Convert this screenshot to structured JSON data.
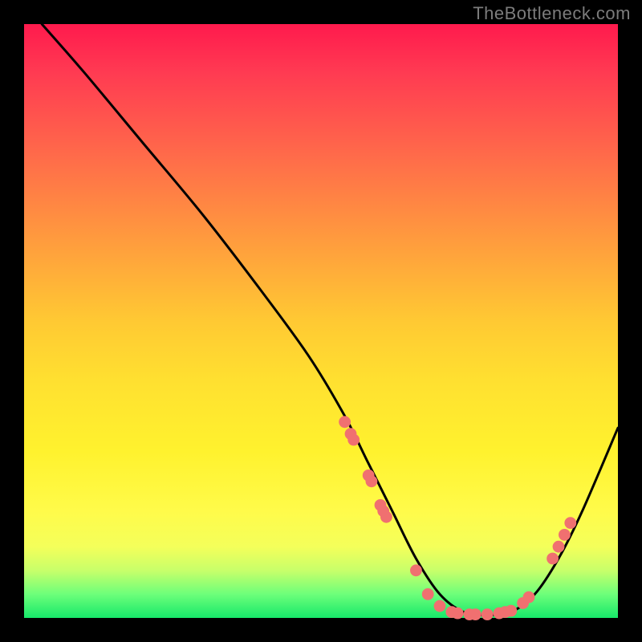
{
  "watermark": "TheBottleneck.com",
  "chart_data": {
    "type": "line",
    "title": "",
    "xlabel": "",
    "ylabel": "",
    "xlim": [
      0,
      100
    ],
    "ylim": [
      0,
      100
    ],
    "grid": false,
    "legend": false,
    "series": [
      {
        "name": "curve",
        "color": "#000000",
        "x": [
          3,
          10,
          20,
          30,
          40,
          48,
          54,
          58,
          62,
          66,
          70,
          74,
          78,
          82,
          86,
          90,
          94,
          100
        ],
        "y": [
          100,
          92,
          80,
          68,
          55,
          44,
          34,
          26,
          18,
          10,
          4,
          1,
          0.5,
          1,
          4,
          10,
          18,
          32
        ]
      }
    ],
    "points": {
      "name": "markers",
      "color": "#f07070",
      "radius_frac": 0.01,
      "xy": [
        [
          54,
          33
        ],
        [
          55,
          31
        ],
        [
          55.5,
          30
        ],
        [
          58,
          24
        ],
        [
          58.5,
          23
        ],
        [
          60,
          19
        ],
        [
          60.5,
          18
        ],
        [
          61,
          17
        ],
        [
          66,
          8
        ],
        [
          68,
          4
        ],
        [
          70,
          2
        ],
        [
          72,
          1
        ],
        [
          73,
          0.8
        ],
        [
          75,
          0.6
        ],
        [
          76,
          0.6
        ],
        [
          78,
          0.6
        ],
        [
          80,
          0.8
        ],
        [
          81,
          1
        ],
        [
          82,
          1.2
        ],
        [
          84,
          2.5
        ],
        [
          85,
          3.5
        ],
        [
          89,
          10
        ],
        [
          90,
          12
        ],
        [
          91,
          14
        ],
        [
          92,
          16
        ]
      ]
    }
  }
}
